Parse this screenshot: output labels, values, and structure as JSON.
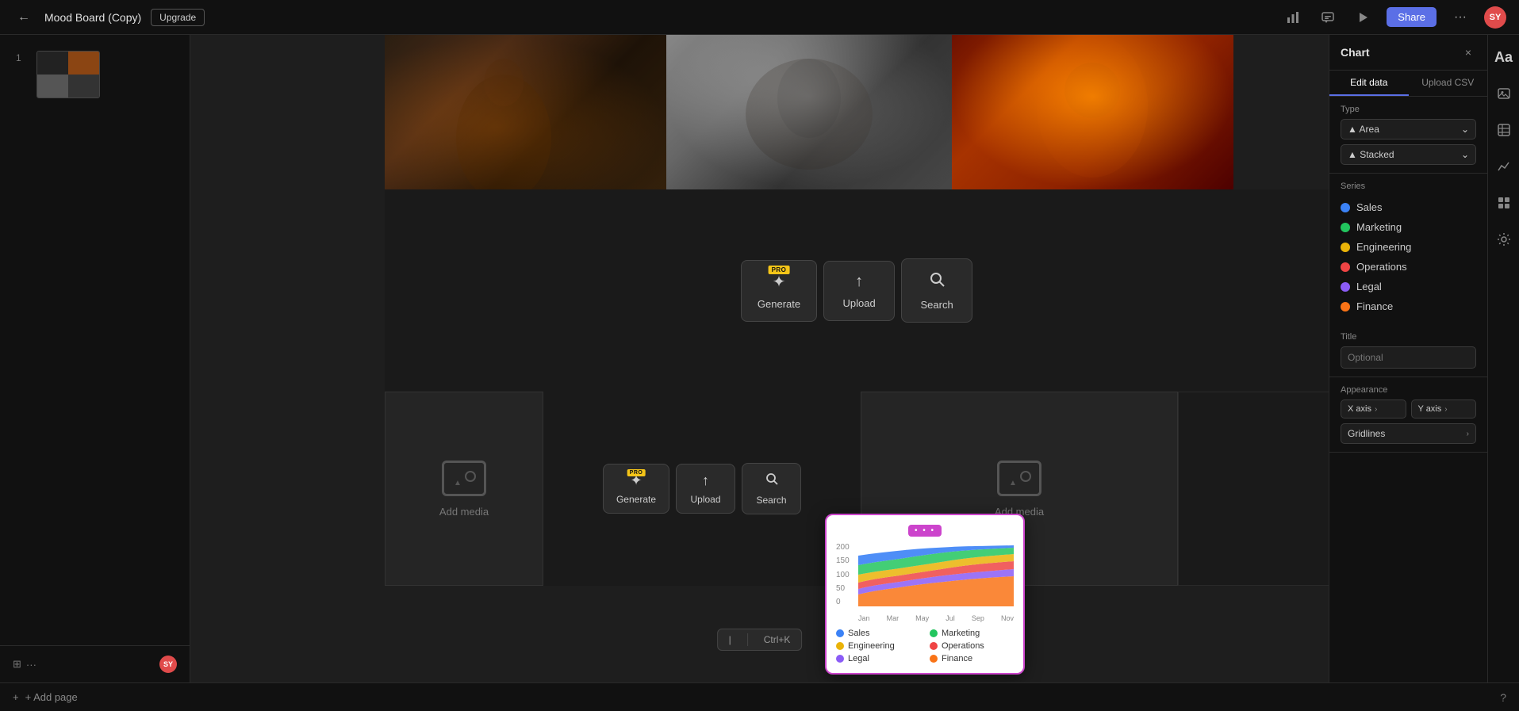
{
  "topbar": {
    "back_label": "←",
    "title": "Mood Board (Copy)",
    "upgrade_label": "Upgrade",
    "share_label": "Share",
    "more_label": "···",
    "avatar_initials": "SY"
  },
  "toolbar_icons": {
    "bar_chart": "📊",
    "comment": "💬",
    "present": "▶"
  },
  "sidebar": {
    "page_number": "1",
    "add_page_label": "+ Add page"
  },
  "canvas": {
    "generate_label": "Generate",
    "upload_label": "Upload",
    "search_label": "Search",
    "add_media_label": "Add media",
    "pro_badge": "PRO"
  },
  "chart_popup": {
    "handle_dots": "• • •",
    "y_labels": [
      "200",
      "150",
      "100",
      "50",
      "0"
    ],
    "x_labels": [
      "Jan",
      "Mar",
      "May",
      "Jul",
      "Sep",
      "Nov"
    ],
    "legend": [
      {
        "label": "Sales",
        "color": "#3b82f6"
      },
      {
        "label": "Marketing",
        "color": "#22c55e"
      },
      {
        "label": "Engineering",
        "color": "#eab308"
      },
      {
        "label": "Operations",
        "color": "#ef4444"
      },
      {
        "label": "Legal",
        "color": "#8b5cf6"
      },
      {
        "label": "Finance",
        "color": "#f97316"
      }
    ]
  },
  "right_panel": {
    "title": "Chart",
    "close_label": "×",
    "tab_edit": "Edit data",
    "tab_upload": "Upload CSV",
    "type_label": "Type",
    "type_value": "Area",
    "type_option2": "Stacked",
    "series_label": "Series",
    "series_items": [
      {
        "name": "Sales",
        "color": "#3b82f6"
      },
      {
        "name": "Marketing",
        "color": "#22c55e"
      },
      {
        "name": "Engineering",
        "color": "#eab308"
      },
      {
        "name": "Operations",
        "color": "#ef4444"
      },
      {
        "name": "Legal",
        "color": "#8b5cf6"
      },
      {
        "name": "Finance",
        "color": "#f97316"
      }
    ],
    "title_label": "Title",
    "title_placeholder": "Optional",
    "appearance_label": "Appearance",
    "x_axis_label": "X axis",
    "y_axis_label": "Y axis",
    "gridlines_label": "Gridlines"
  },
  "shortcut": {
    "cursor_label": "|",
    "key_label": "Ctrl+K"
  }
}
